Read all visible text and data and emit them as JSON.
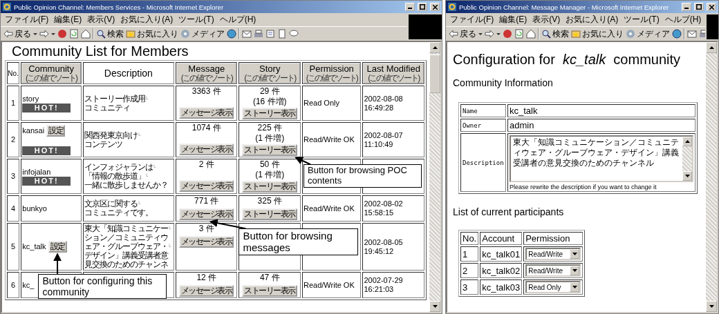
{
  "members_window": {
    "title": "Public Opinion Channel: Members Services - Microsoft Internet Explorer",
    "menu": [
      "ファイル(F)",
      "編集(E)",
      "表示(V)",
      "お気に入り(A)",
      "ツール(T)",
      "ヘルプ(H)"
    ],
    "toolbar": [
      "戻る",
      "検索",
      "お気に入り",
      "メディア"
    ],
    "heading": "Community List for Members",
    "columns": [
      {
        "kind": "plain",
        "label": "No."
      },
      {
        "kind": "sort",
        "label": "Community",
        "sub": "(この値でソート)"
      },
      {
        "kind": "plain",
        "label": "Description"
      },
      {
        "kind": "sort",
        "label": "Message",
        "sub": "(この値でソート)"
      },
      {
        "kind": "sort",
        "label": "Story",
        "sub": "(この値でソート)"
      },
      {
        "kind": "sort",
        "label": "Permission",
        "sub": "(この値でソート)"
      },
      {
        "kind": "sort",
        "label": "Last Modified",
        "sub": "(この値でソート)"
      }
    ],
    "rows": [
      {
        "no": "1",
        "community": "story",
        "badge": "HOT!",
        "description": [
          "ストーリー作成用$^{└}$",
          "コミュニティ"
        ],
        "message": {
          "count": "3363 件",
          "button": "メッセージ表示"
        },
        "story": {
          "count": "29 件",
          "increase": "(16 件増)",
          "button": "ストーリー表示"
        },
        "permission": "Read Only",
        "modified": [
          "2002-08-08",
          "16:49:28"
        ]
      },
      {
        "no": "2",
        "community": "kansai",
        "settings": "設定",
        "badge": "HOT!",
        "description": [
          "関西発東京向け$^{└}$",
          "コンテンツ"
        ],
        "message": {
          "count": "1074 件",
          "button": "メッセージ表示"
        },
        "story": {
          "count": "225 件",
          "increase": "(1 件増)",
          "button": "ストーリー表示"
        },
        "permission": "Read/Write OK",
        "modified": [
          "2002-08-07",
          "11:10:49"
        ]
      },
      {
        "no": "3",
        "community": "infojalan",
        "badge": "HOT!",
        "description": [
          "インフォジャランは$^{└}$",
          "「情報の散歩道」$^{└}$",
          "一緒に散歩しませんか？"
        ],
        "message": {
          "count": "2 件",
          "button": "メッセージ表示"
        },
        "story": {
          "count": "50 件",
          "increase": "(1 件増)",
          "button": "ストーリー表示"
        }
      },
      {
        "no": "4",
        "community": "bunkyo",
        "description": [
          "文京区に関する$^{└}$",
          "コミュニティです。"
        ],
        "message": {
          "count": "771 件",
          "button": "メッセージ表示"
        },
        "story": {
          "count": "325 件",
          "button": "ストーリー表示"
        },
        "permission": "Read/Write OK",
        "modified": [
          "2002-08-02",
          "15:58:15"
        ]
      },
      {
        "no": "5",
        "community": "kc_talk",
        "settings": "設定",
        "description": [
          "東大「知識コミュニケー$^{└}$",
          "ション／コミュニティウ",
          "ェア・グループウェア・$^{└}$",
          "デザイン」講義受講者意",
          "見交換のためのチャンネ"
        ],
        "message": {
          "count": "3 件",
          "button": "メッセージ表示"
        },
        "modified": [
          "2002-08-05",
          "19:45:12"
        ]
      },
      {
        "no": "6",
        "community": "kc_",
        "message": {
          "count": "12 件",
          "button": "メッセージ表示"
        },
        "story": {
          "count": "47 件",
          "button": "ストーリー表示"
        },
        "permission": "Read/Write OK",
        "modified": [
          "2002-07-29",
          "16:21:03"
        ]
      }
    ],
    "callouts": [
      "Button for browsing POC contents",
      "Button for browsing messages",
      "Button for configuring this community"
    ]
  },
  "manager_window": {
    "title": "Public Opinion Channel: Message Manager - Microsoft Internet Explorer",
    "menu": [
      "ファイル(F)",
      "編集(E)",
      "表示(V)",
      "お気に入り(A)",
      "ツール(T)",
      "ヘルプ(H)"
    ],
    "toolbar": [
      "戻る",
      "検索",
      "お気に入り",
      "メディア"
    ],
    "heading": "Configuration for  *kc_talk*  community",
    "info_heading": "Community Information",
    "info": [
      {
        "kind": "text",
        "label": "Name",
        "value": "kc_talk"
      },
      {
        "kind": "text",
        "label": "Owner",
        "value": "admin"
      },
      {
        "kind": "textarea",
        "label": "Description",
        "value": "東大「知識コミュニケーション／コミュニティウェア・グループウェア・デザイン」講義受講者の意見交換のためのチャンネル",
        "note": "Please rewrite the description if you want to change it"
      }
    ],
    "participants_heading": "List of current participants",
    "participant_columns": [
      "No.",
      "Account",
      "Permission"
    ],
    "participants": [
      {
        "no": "1",
        "account": "kc_talk01",
        "permission": "Read/Write"
      },
      {
        "no": "2",
        "account": "kc_talk02",
        "permission": "Read/Write"
      },
      {
        "no": "3",
        "account": "kc_talk03",
        "permission": "Read Only"
      }
    ]
  }
}
